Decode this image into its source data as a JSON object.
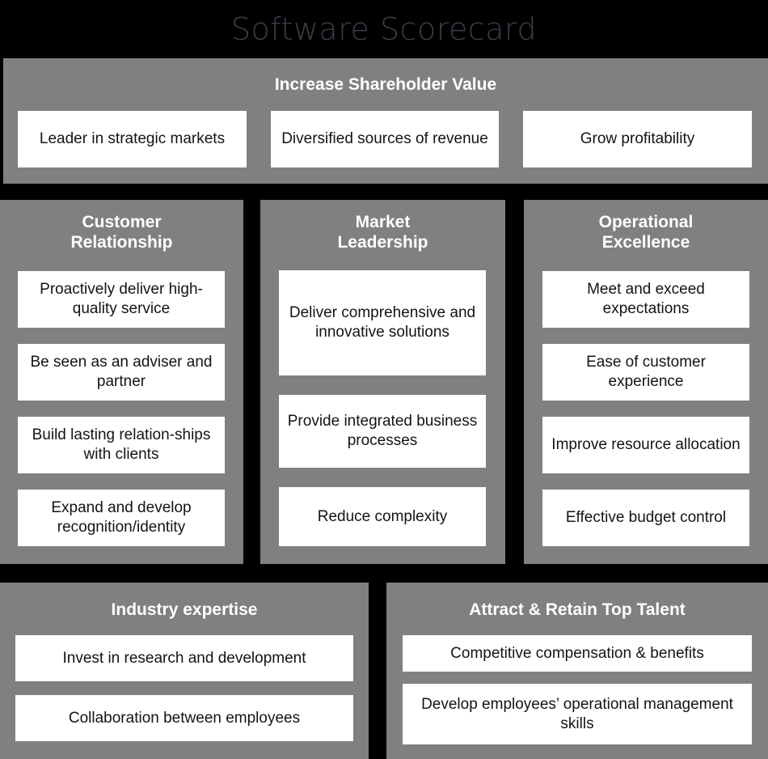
{
  "title": "Software Scorecard",
  "colors": {
    "background": "#000000",
    "panel": "#808080",
    "box": "#ffffff",
    "box_text": "#141414",
    "panel_title": "#ffffff",
    "title_text": "#3b3e48"
  },
  "shareholder": {
    "heading": "Increase Shareholder Value",
    "objectives": [
      "Leader in strategic markets",
      "Diversified sources of revenue",
      "Grow profitability"
    ]
  },
  "customer": {
    "heading_line1": "Customer",
    "heading_line2": "Relationship",
    "objectives": [
      "Proactively deliver high-quality service",
      "Be seen as an adviser and partner",
      "Build lasting relation-ships with clients",
      "Expand and develop recognition/identity"
    ]
  },
  "market": {
    "heading_line1": "Market",
    "heading_line2": "Leadership",
    "objectives": [
      "Deliver comprehensive and innovative solutions",
      "Provide integrated business processes",
      "Reduce complexity"
    ]
  },
  "operational": {
    "heading_line1": "Operational",
    "heading_line2": "Excellence",
    "objectives": [
      "Meet and exceed expectations",
      "Ease of customer experience",
      "Improve resource allocation",
      "Effective budget control"
    ]
  },
  "industry": {
    "heading": "Industry expertise",
    "objectives": [
      "Invest in research and development",
      "Collaboration between employees"
    ]
  },
  "talent": {
    "heading": "Attract & Retain Top Talent",
    "objectives": [
      "Competitive compensation & benefits",
      "Develop employees’ operational management skills"
    ]
  }
}
